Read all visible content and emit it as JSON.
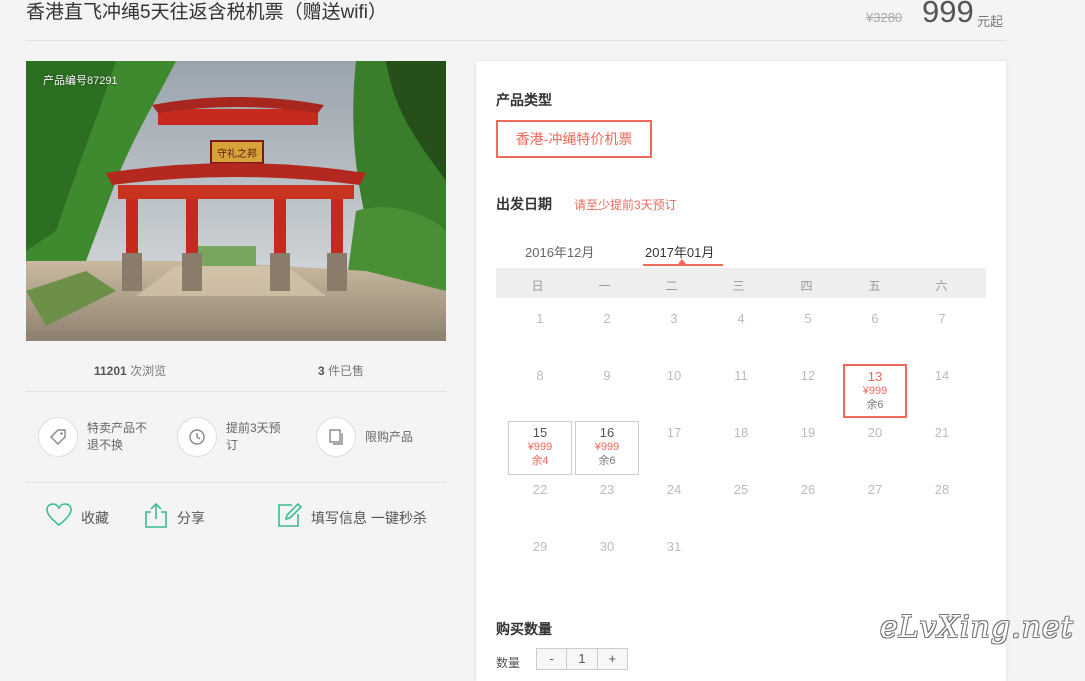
{
  "header": {
    "title": "香港直飞冲绳5天往返含税机票（赠送wifi）",
    "old_price": "¥3280",
    "price": "999",
    "price_unit": "元起"
  },
  "photo": {
    "code": "产品编号87291",
    "sign": "守礼之邦"
  },
  "stats": {
    "views_count": "11201",
    "views_label": "次浏览",
    "sold_count": "3",
    "sold_label": "件已售"
  },
  "features": [
    {
      "icon": "tag-icon",
      "text": "特卖产品不退不换"
    },
    {
      "icon": "clock-icon",
      "text": "提前3天预订"
    },
    {
      "icon": "copy-icon",
      "text": "限购产品"
    }
  ],
  "actions": [
    {
      "icon": "heart-icon",
      "label": "收藏"
    },
    {
      "icon": "share-icon",
      "label": "分享"
    },
    {
      "icon": "edit-icon",
      "label": "填写信息 一键秒杀"
    }
  ],
  "panel": {
    "product_type_title": "产品类型",
    "product_type_option": "香港-冲绳特价机票",
    "date_title": "出发日期",
    "date_hint": "请至少提前3天预订",
    "months": [
      "2016年12月",
      "2017年01月"
    ],
    "weekdays": [
      "日",
      "一",
      "二",
      "三",
      "四",
      "五",
      "六"
    ],
    "days": {
      "r1": [
        "1",
        "2",
        "3",
        "4",
        "5",
        "6",
        "7"
      ],
      "r2": [
        "8",
        "9",
        "10",
        "11",
        "12",
        "14"
      ],
      "r3": [
        "17",
        "18",
        "19",
        "20",
        "21"
      ],
      "r4": [
        "22",
        "23",
        "24",
        "25",
        "26",
        "27",
        "28"
      ],
      "r5": [
        "29",
        "30",
        "31"
      ]
    },
    "available_days": [
      {
        "day": "13",
        "price": "¥999",
        "left": "余6"
      },
      {
        "day": "15",
        "price": "¥999",
        "left": "余4"
      },
      {
        "day": "16",
        "price": "¥999",
        "left": "余6"
      }
    ],
    "quantity_title": "购买数量",
    "quantity_label": "数量",
    "quantity": {
      "minus": "-",
      "value": "1",
      "plus": "+"
    }
  },
  "watermark": "eLvXing.net",
  "colors": {
    "accent": "#f0695a",
    "icon_green": "#3dbb8f"
  }
}
